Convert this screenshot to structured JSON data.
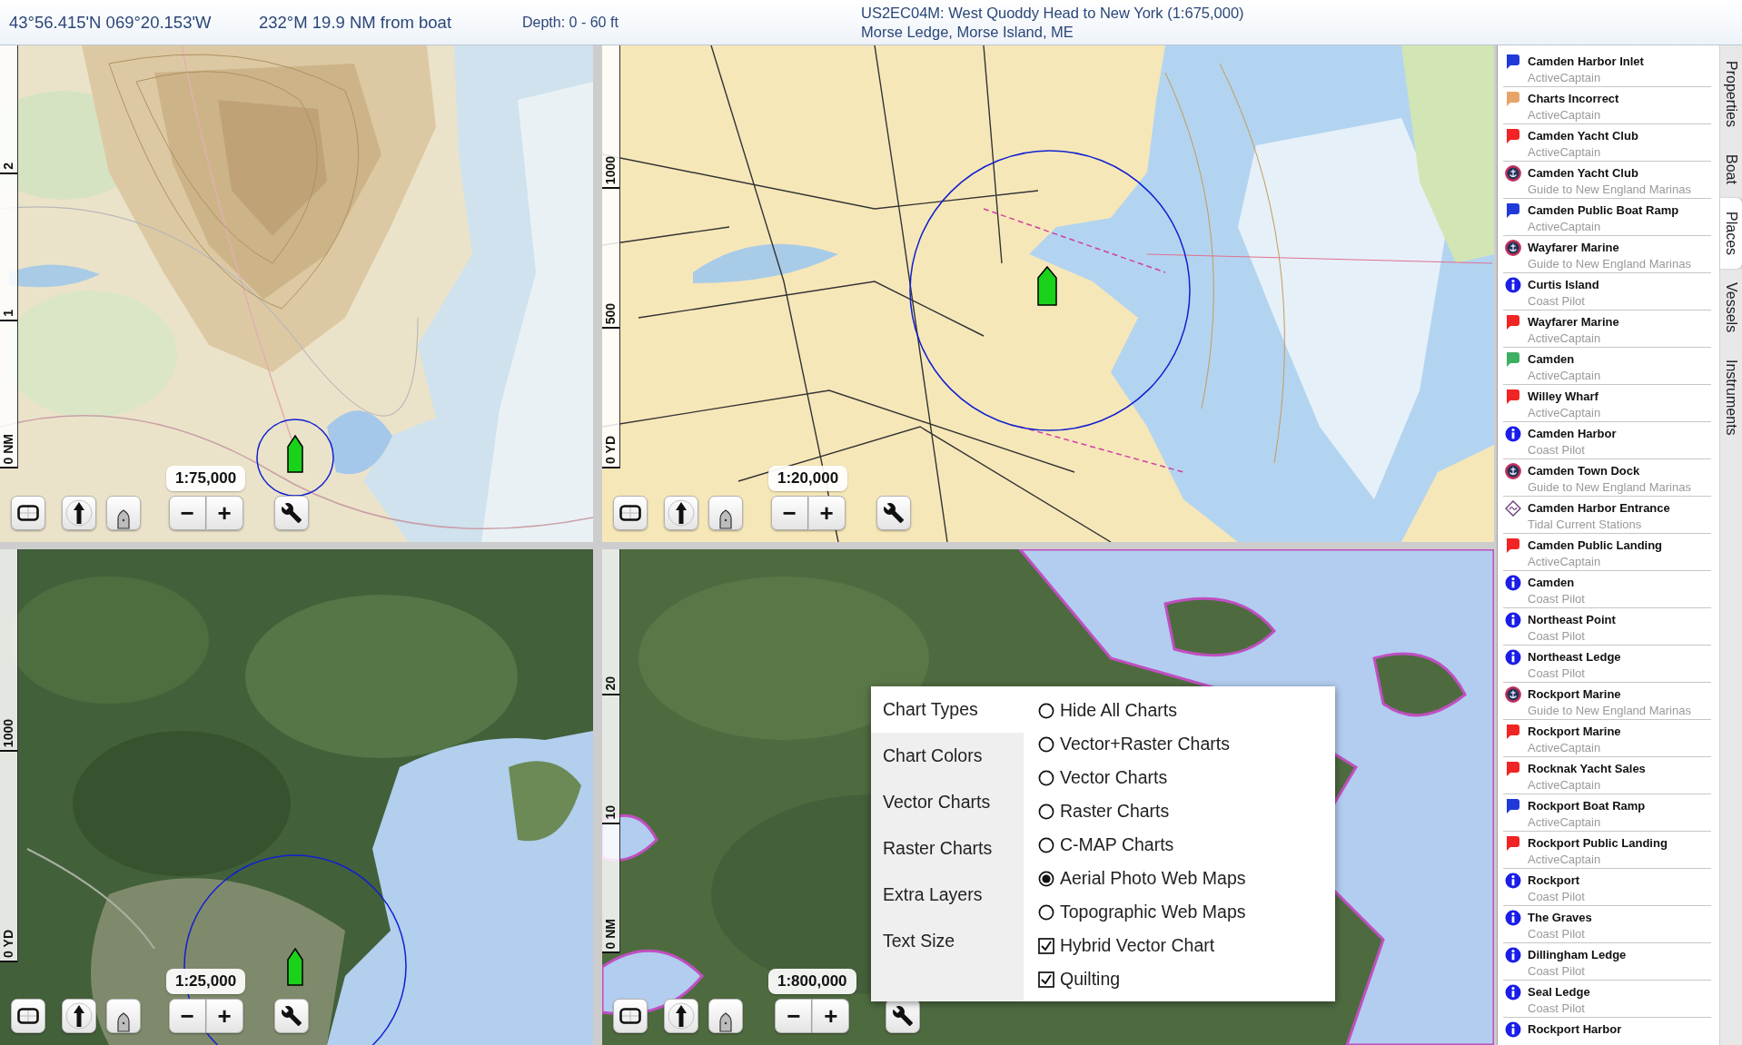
{
  "status_bar": {
    "position": "43°56.415'N 069°20.153'W",
    "bearing": "232°M 19.9 NM from boat",
    "depth": "Depth: 0 - 60 ft",
    "chart": "US2EC04M: West Quoddy Head to New York (1:675,000)",
    "place": "Morse Ledge, Morse Island, ME"
  },
  "map_panes": [
    {
      "kind": "topographic",
      "scale": "1:75,000",
      "ruler": [
        "0 NM",
        "1",
        "2"
      ],
      "zoom_out": "−",
      "zoom_in": "+"
    },
    {
      "kind": "nautical",
      "scale": "1:20,000",
      "ruler": [
        "0 YD",
        "500",
        "1000"
      ],
      "zoom_out": "−",
      "zoom_in": "+"
    },
    {
      "kind": "aerial",
      "scale": "1:25,000",
      "ruler": [
        "0 YD",
        "1000"
      ],
      "zoom_out": "−",
      "zoom_in": "+"
    },
    {
      "kind": "hybrid",
      "scale": "1:800,000",
      "ruler": [
        "0 NM",
        "10",
        "20"
      ],
      "zoom_out": "−",
      "zoom_in": "+",
      "menu": {
        "categories": [
          {
            "label": "Chart Types",
            "selected": true
          },
          {
            "label": "Chart Colors",
            "selected": false
          },
          {
            "label": "Vector Charts",
            "selected": false
          },
          {
            "label": "Raster Charts",
            "selected": false
          },
          {
            "label": "Extra Layers",
            "selected": false
          },
          {
            "label": "Text Size",
            "selected": false
          }
        ],
        "options": [
          {
            "kind": "radio",
            "label": "Hide All Charts",
            "selected": false
          },
          {
            "kind": "radio",
            "label": "Vector+Raster Charts",
            "selected": false
          },
          {
            "kind": "radio",
            "label": "Vector Charts",
            "selected": false
          },
          {
            "kind": "radio",
            "label": "Raster Charts",
            "selected": false
          },
          {
            "kind": "radio",
            "label": "C-MAP Charts",
            "selected": false
          },
          {
            "kind": "radio",
            "label": "Aerial Photo Web Maps",
            "selected": true
          },
          {
            "kind": "radio",
            "label": "Topographic Web Maps",
            "selected": false
          },
          {
            "kind": "checkbox",
            "label": "Hybrid Vector Chart",
            "checked": true
          },
          {
            "kind": "checkbox",
            "label": "Quilting",
            "checked": true
          }
        ]
      }
    }
  ],
  "places": [
    {
      "name": "Camden Harbor Inlet",
      "source": "ActiveCaptain",
      "kind": "flag",
      "color": "#1f3ad8"
    },
    {
      "name": "Charts Incorrect",
      "source": "ActiveCaptain",
      "kind": "flag",
      "color": "#e8a468"
    },
    {
      "name": "Camden Yacht Club",
      "source": "ActiveCaptain",
      "kind": "flag",
      "color": "#f02424"
    },
    {
      "name": "Camden Yacht Club",
      "source": "Guide to New England Marinas",
      "kind": "guide"
    },
    {
      "name": "Camden Public Boat Ramp",
      "source": "ActiveCaptain",
      "kind": "flag",
      "color": "#1f3ad8"
    },
    {
      "name": "Wayfarer Marine",
      "source": "Guide to New England Marinas",
      "kind": "guide"
    },
    {
      "name": "Curtis Island",
      "source": "Coast Pilot",
      "kind": "info"
    },
    {
      "name": "Wayfarer Marine",
      "source": "ActiveCaptain",
      "kind": "flag",
      "color": "#f02424"
    },
    {
      "name": "Camden",
      "source": "ActiveCaptain",
      "kind": "flag",
      "color": "#3cb060"
    },
    {
      "name": "Willey Wharf",
      "source": "ActiveCaptain",
      "kind": "flag",
      "color": "#f02424"
    },
    {
      "name": "Camden Harbor",
      "source": "Coast Pilot",
      "kind": "info"
    },
    {
      "name": "Camden Town Dock",
      "source": "Guide to New England Marinas",
      "kind": "guide"
    },
    {
      "name": "Camden Harbor Entrance",
      "source": "Tidal Current Stations",
      "kind": "current"
    },
    {
      "name": "Camden Public Landing",
      "source": "ActiveCaptain",
      "kind": "flag",
      "color": "#f02424"
    },
    {
      "name": "Camden",
      "source": "Coast Pilot",
      "kind": "info"
    },
    {
      "name": "Northeast Point",
      "source": "Coast Pilot",
      "kind": "info"
    },
    {
      "name": "Northeast Ledge",
      "source": "Coast Pilot",
      "kind": "info"
    },
    {
      "name": "Rockport Marine",
      "source": "Guide to New England Marinas",
      "kind": "guide"
    },
    {
      "name": "Rockport Marine",
      "source": "ActiveCaptain",
      "kind": "flag",
      "color": "#f02424"
    },
    {
      "name": "Rocknak Yacht Sales",
      "source": "ActiveCaptain",
      "kind": "flag",
      "color": "#f02424"
    },
    {
      "name": "Rockport Boat Ramp",
      "source": "ActiveCaptain",
      "kind": "flag",
      "color": "#1f3ad8"
    },
    {
      "name": "Rockport Public Landing",
      "source": "ActiveCaptain",
      "kind": "flag",
      "color": "#f02424"
    },
    {
      "name": "Rockport",
      "source": "Coast Pilot",
      "kind": "info"
    },
    {
      "name": "The Graves",
      "source": "Coast Pilot",
      "kind": "info"
    },
    {
      "name": "Dillingham Ledge",
      "source": "Coast Pilot",
      "kind": "info"
    },
    {
      "name": "Seal Ledge",
      "source": "Coast Pilot",
      "kind": "info"
    },
    {
      "name": "Rockport Harbor",
      "kind": "info"
    }
  ],
  "side_tabs": [
    {
      "label": "Properties",
      "selected": false
    },
    {
      "label": "Boat",
      "selected": false
    },
    {
      "label": "Places",
      "selected": true
    },
    {
      "label": "Vessels",
      "selected": false
    },
    {
      "label": "Instruments",
      "selected": false
    }
  ]
}
